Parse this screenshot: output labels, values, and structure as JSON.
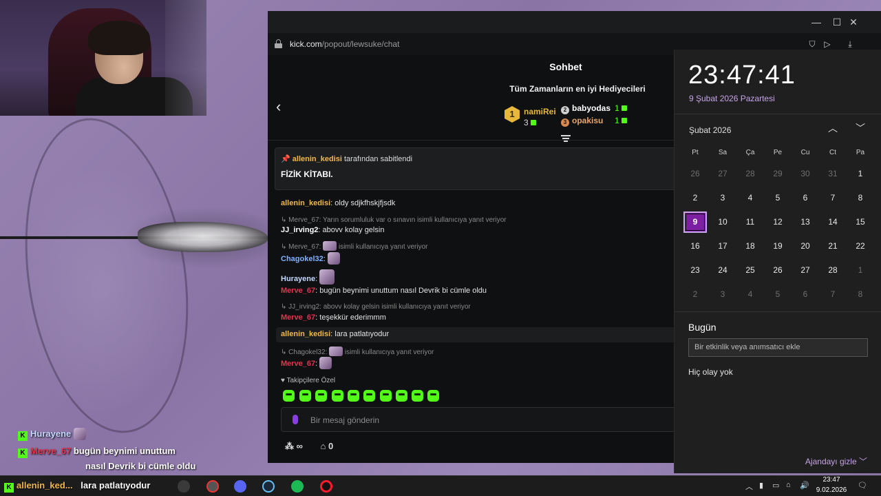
{
  "browser": {
    "url_domain": "kick.com",
    "url_path": "/popout/lewsuke/chat"
  },
  "chat": {
    "title": "Sohbet",
    "gifters_title": "Tüm Zamanların en iyi Hediyecileri",
    "top_gifters": [
      {
        "rank": "1",
        "name": "namiRei",
        "count": "3"
      },
      {
        "rank": "2",
        "name": "babyodas",
        "count": "1"
      },
      {
        "rank": "3",
        "name": "opakisu",
        "count": "1"
      }
    ],
    "pinned": {
      "by_user": "allenin_kedisi",
      "by_suffix": "tarafından sabitlendi",
      "text": "FİZİK KİTABI."
    },
    "messages": [
      {
        "user": "allenin_kedisi",
        "color": "#f2b84b",
        "text": "oldy sdjkfhskjfjsdk"
      },
      {
        "reply": "Merve_67: Yarın sorumluluk var o sınavın isimli kullanıcıya yanıt veriyor",
        "user": "JJ_irving2",
        "color": "#ffffff",
        "text": "abovv kolay gelsin"
      },
      {
        "reply_user": "Merve_67:",
        "reply_suffix": "isimli kullanıcıya yanıt veriyor",
        "user": "Chagokel32",
        "color": "#7fb2ff",
        "text": ""
      },
      {
        "user": "Hurayene",
        "color": "#c3d7ff",
        "text": ""
      },
      {
        "user": "Merve_67",
        "color": "#e8334f",
        "text": "bugün beynimi unuttum nasıl Devrik bi cümle oldu"
      },
      {
        "reply": "JJ_irving2: abovv kolay gelsin isimli kullanıcıya yanıt veriyor",
        "user": "Merve_67",
        "color": "#e8334f",
        "text": "teşekkür ederimmm"
      },
      {
        "user": "allenin_kedisi",
        "color": "#f2b84b",
        "text": "lara patlatıyodur"
      },
      {
        "reply_user": "Chagokel32:",
        "reply_suffix": "isimli kullanıcıya yanıt veriyor",
        "user": "Merve_67",
        "color": "#e8334f",
        "text": ""
      }
    ],
    "followers_only": "Takipçilere Özel",
    "input_placeholder": "Bir mesaj gönderin",
    "viewers": "∞",
    "store_count": "0"
  },
  "calendar": {
    "time": "23:47:41",
    "date": "9 Şubat 2026 Pazartesi",
    "month": "Şubat 2026",
    "weekdays": [
      "Pt",
      "Sa",
      "Ça",
      "Pe",
      "Cu",
      "Ct",
      "Pa"
    ],
    "days": [
      [
        "26",
        "27",
        "28",
        "29",
        "30",
        "31",
        "1"
      ],
      [
        "2",
        "3",
        "4",
        "5",
        "6",
        "7",
        "8"
      ],
      [
        "9",
        "10",
        "11",
        "12",
        "13",
        "14",
        "15"
      ],
      [
        "16",
        "17",
        "18",
        "19",
        "20",
        "21",
        "22"
      ],
      [
        "23",
        "24",
        "25",
        "26",
        "27",
        "28",
        "1"
      ],
      [
        "2",
        "3",
        "4",
        "5",
        "6",
        "7",
        "8"
      ]
    ],
    "today_label": "Bugün",
    "event_placeholder": "Bir etkinlik veya anımsatıcı ekle",
    "no_events": "Hiç olay yok",
    "hide_agenda": "Ajandayı gizle",
    "accent": "#c7a4e8",
    "today_fill": "#7d1fa3"
  },
  "overlay": {
    "rows": [
      {
        "user": "Hurayene",
        "color": "#c3d7ff",
        "text": ""
      },
      {
        "user": "Merve_67",
        "color": "#e8334f",
        "text": "bugün beynimi unuttum"
      },
      {
        "user": "",
        "color": "#ffffff",
        "text": "nasıl Devrik bi cümle oldu"
      },
      {
        "user": "allenin_ked...",
        "color": "#f2b84b",
        "text": "lara patlatıyodur"
      }
    ]
  },
  "taskbar": {
    "clock_time": "23:47",
    "clock_date": "9.02.2026"
  }
}
